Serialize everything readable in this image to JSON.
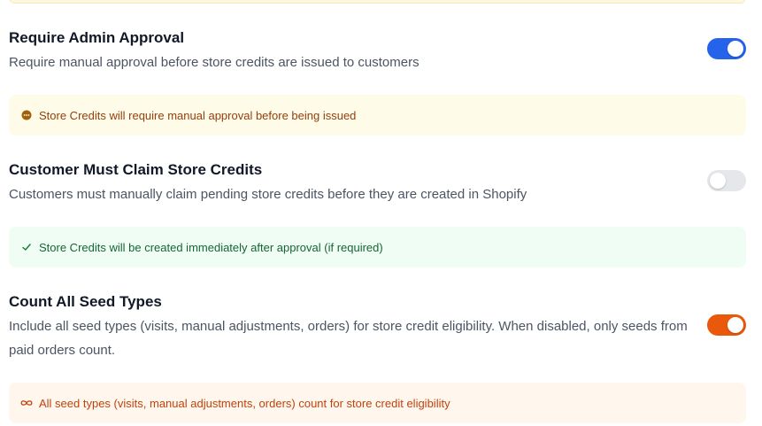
{
  "settings": [
    {
      "title": "Require Admin Approval",
      "description": "Require manual approval before store credits are issued to customers",
      "toggle_state": "on",
      "toggle_color": "#2563eb"
    },
    {
      "title": "Customer Must Claim Store Credits",
      "description": "Customers must manually claim pending store credits before they are created in Shopify",
      "toggle_state": "off",
      "toggle_color": "#e5e7eb"
    },
    {
      "title": "Count All Seed Types",
      "description": "Include all seed types (visits, manual adjustments, orders) for store credit eligibility. When disabled, only seeds from paid orders count.",
      "toggle_state": "on",
      "toggle_color": "#ea580c"
    }
  ],
  "notices": [
    {
      "text": "Store Credits will require manual approval before being issued",
      "icon": "clock-icon",
      "bg_color": "#fefbe8",
      "text_color": "#92400e"
    },
    {
      "text": "Store Credits will be created immediately after approval (if required)",
      "icon": "check-icon",
      "bg_color": "#f0fdf4",
      "text_color": "#166534"
    },
    {
      "text": "All seed types (visits, manual adjustments, orders) count for store credit eligibility",
      "icon": "infinity-icon",
      "bg_color": "#fff7ed",
      "text_color": "#c2410c"
    }
  ]
}
